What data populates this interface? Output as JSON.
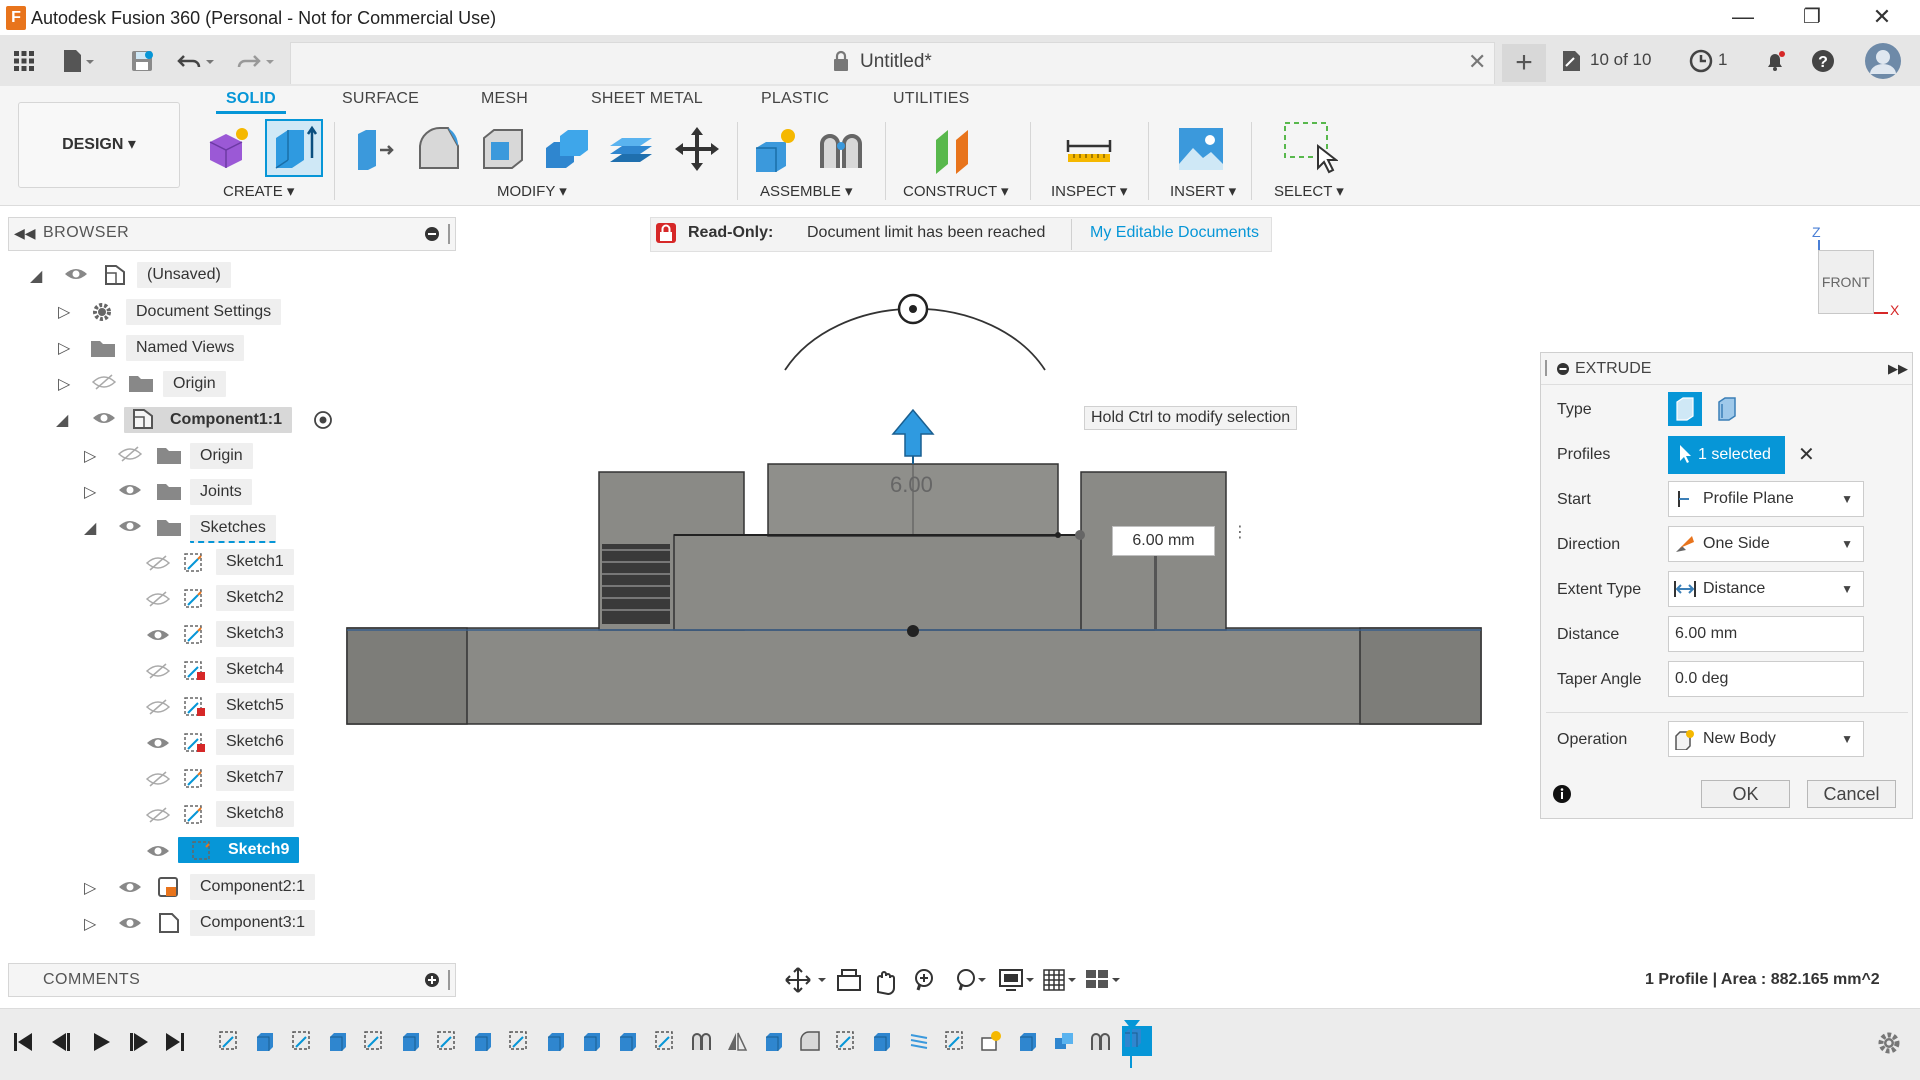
{
  "window": {
    "title": "Autodesk Fusion 360 (Personal - Not for Commercial Use)",
    "controls": [
      "—",
      "❐",
      "✕"
    ]
  },
  "document": {
    "title": "Untitled*",
    "version_count": "10 of 10",
    "job_count": "1"
  },
  "ribbon": {
    "tabs": [
      "SOLID",
      "SURFACE",
      "MESH",
      "SHEET METAL",
      "PLASTIC",
      "UTILITIES"
    ],
    "active_tab": "SOLID",
    "workspace": "DESIGN ▾",
    "groups": [
      "CREATE ▾",
      "MODIFY ▾",
      "ASSEMBLE ▾",
      "CONSTRUCT ▾",
      "INSPECT ▾",
      "INSERT ▾",
      "SELECT ▾"
    ]
  },
  "banner": {
    "label": "Read-Only:",
    "message": "Document limit has been reached",
    "link": "My Editable Documents"
  },
  "browser": {
    "title": "BROWSER",
    "items": [
      {
        "label": "(Unsaved)"
      },
      {
        "label": "Document Settings"
      },
      {
        "label": "Named Views"
      },
      {
        "label": "Origin"
      },
      {
        "label": "Component1:1"
      },
      {
        "label": "Origin"
      },
      {
        "label": "Joints"
      },
      {
        "label": "Sketches"
      },
      {
        "label": "Sketch1"
      },
      {
        "label": "Sketch2"
      },
      {
        "label": "Sketch3"
      },
      {
        "label": "Sketch4"
      },
      {
        "label": "Sketch5"
      },
      {
        "label": "Sketch6"
      },
      {
        "label": "Sketch7"
      },
      {
        "label": "Sketch8"
      },
      {
        "label": "Sketch9"
      },
      {
        "label": "Component2:1"
      },
      {
        "label": "Component3:1"
      }
    ]
  },
  "comments": {
    "title": "COMMENTS"
  },
  "canvas": {
    "tooltip": "Hold Ctrl to modify selection",
    "distance_input": "6.00 mm",
    "dimension_label": "6.00",
    "view_cube": {
      "face": "FRONT",
      "axis_z": "Z",
      "axis_x": "X"
    }
  },
  "extrude": {
    "title": "EXTRUDE",
    "type_label": "Type",
    "profiles_label": "Profiles",
    "profiles_value": "1 selected",
    "start_label": "Start",
    "start_value": "Profile Plane",
    "direction_label": "Direction",
    "direction_value": "One Side",
    "extent_label": "Extent Type",
    "extent_value": "Distance",
    "distance_label": "Distance",
    "distance_value": "6.00 mm",
    "taper_label": "Taper Angle",
    "taper_value": "0.0 deg",
    "operation_label": "Operation",
    "operation_value": "New Body",
    "ok": "OK",
    "cancel": "Cancel"
  },
  "status": {
    "text": "1 Profile | Area : 882.165 mm^2"
  },
  "colors": {
    "accent": "#0696d7",
    "lock_red": "#d62828",
    "body_gray": "#8a8a86"
  }
}
